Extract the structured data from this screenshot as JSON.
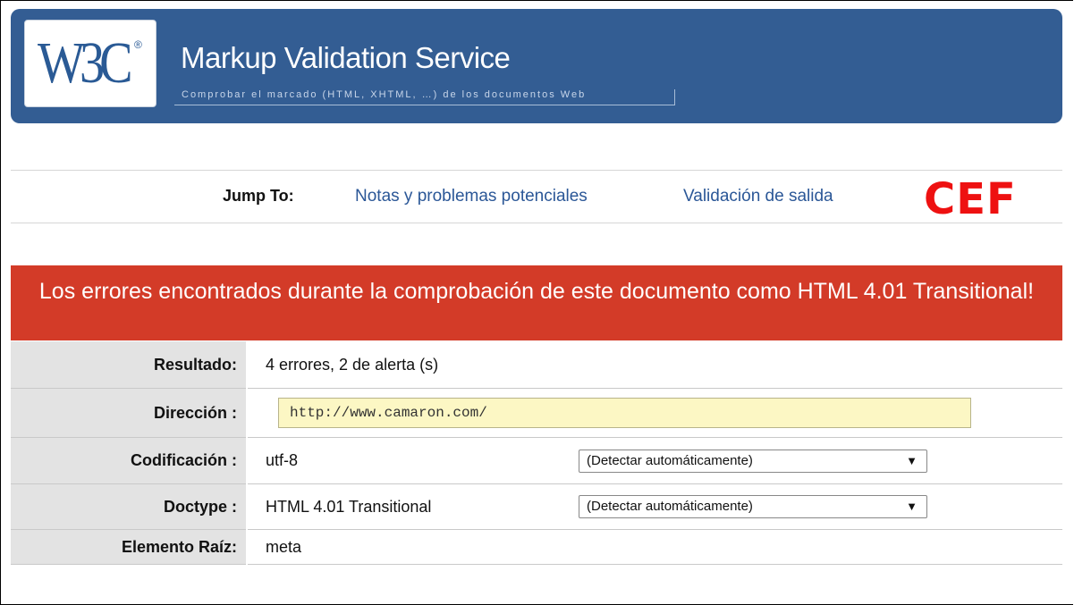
{
  "header": {
    "logo_text": "W3C",
    "logo_reg": "®",
    "title": "Markup Validation Service",
    "subtitle": "Comprobar el marcado (HTML, XHTML, …) de los documentos Web"
  },
  "jump": {
    "label": "Jump To:",
    "links": [
      "Notas y problemas potenciales",
      "Validación de salida"
    ]
  },
  "stamp": "CEF",
  "result_banner": "Los errores encontrados durante la comprobación de este documento como HTML 4.01 Transitional!",
  "rows": {
    "result": {
      "label": "Resultado:",
      "value": "4 errores, 2 de alerta (s)"
    },
    "address": {
      "label": "Dirección :",
      "value": "http://www.camaron.com/"
    },
    "encoding": {
      "label": "Codificación :",
      "value": "utf-8",
      "select": "(Detectar automáticamente)"
    },
    "doctype": {
      "label": "Doctype :",
      "value": "HTML 4.01 Transitional",
      "select": "(Detectar automáticamente)"
    },
    "root": {
      "label": "Elemento Raíz:",
      "value": "meta"
    }
  },
  "icons": {
    "dropdown": "triangle-down-icon"
  },
  "colors": {
    "banner": "#335d93",
    "error": "#d33b28",
    "link": "#2b5797",
    "stamp": "#ee1111"
  }
}
